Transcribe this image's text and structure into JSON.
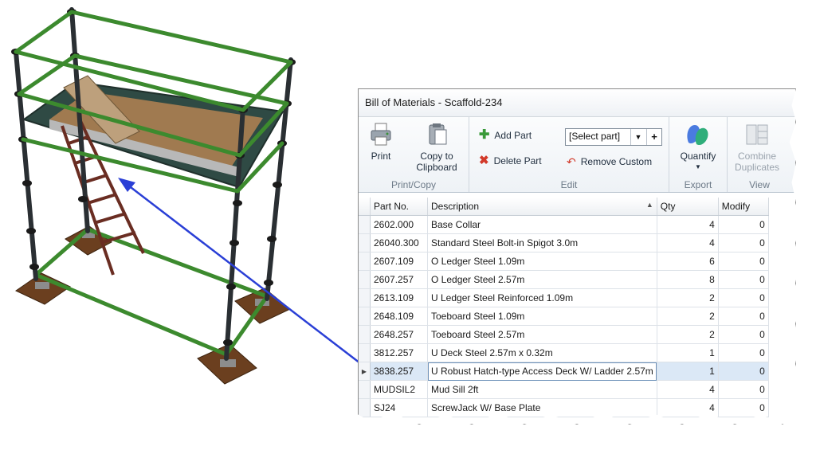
{
  "window": {
    "title": "Bill of Materials - Scaffold-234"
  },
  "ribbon": {
    "print_copy": {
      "print_label": "Print",
      "copy_label_line1": "Copy to",
      "copy_label_line2": "Clipboard",
      "group_label": "Print/Copy"
    },
    "edit": {
      "add_part_label": "Add Part",
      "delete_part_label": "Delete Part",
      "part_select_value": "[Select part]",
      "remove_custom_label": "Remove Custom",
      "group_label": "Edit"
    },
    "export": {
      "quantify_label": "Quantify",
      "group_label": "Export"
    },
    "view": {
      "combine_label_line1": "Combine",
      "combine_label_line2": "Duplicates",
      "group_label": "View"
    }
  },
  "table": {
    "columns": [
      "Part No.",
      "Description",
      "Qty",
      "Modify"
    ],
    "rows": [
      {
        "part": "2602.000",
        "desc": "Base Collar",
        "qty": "4",
        "modify": "0"
      },
      {
        "part": "26040.300",
        "desc": "Standard Steel Bolt-in Spigot 3.0m",
        "qty": "4",
        "modify": "0"
      },
      {
        "part": "2607.109",
        "desc": "O Ledger Steel 1.09m",
        "qty": "6",
        "modify": "0"
      },
      {
        "part": "2607.257",
        "desc": "O Ledger Steel 2.57m",
        "qty": "8",
        "modify": "0"
      },
      {
        "part": "2613.109",
        "desc": "U Ledger Steel Reinforced 1.09m",
        "qty": "2",
        "modify": "0"
      },
      {
        "part": "2648.109",
        "desc": "Toeboard Steel 1.09m",
        "qty": "2",
        "modify": "0"
      },
      {
        "part": "2648.257",
        "desc": "Toeboard Steel 2.57m",
        "qty": "2",
        "modify": "0"
      },
      {
        "part": "3812.257",
        "desc": "U Deck Steel 2.57m x 0.32m",
        "qty": "1",
        "modify": "0"
      },
      {
        "part": "3838.257",
        "desc": "U Robust Hatch-type Access Deck W/ Ladder 2.57m",
        "qty": "1",
        "modify": "0",
        "selected": true
      },
      {
        "part": "MUDSIL2",
        "desc": "Mud Sill 2ft",
        "qty": "4",
        "modify": "0"
      },
      {
        "part": "SJ24",
        "desc": "ScrewJack W/ Base Plate",
        "qty": "4",
        "modify": "0"
      }
    ]
  },
  "colors": {
    "accent": "#2a3fd6",
    "ledger_green": "#3c8a2e",
    "selection": "#dbe8f6"
  }
}
